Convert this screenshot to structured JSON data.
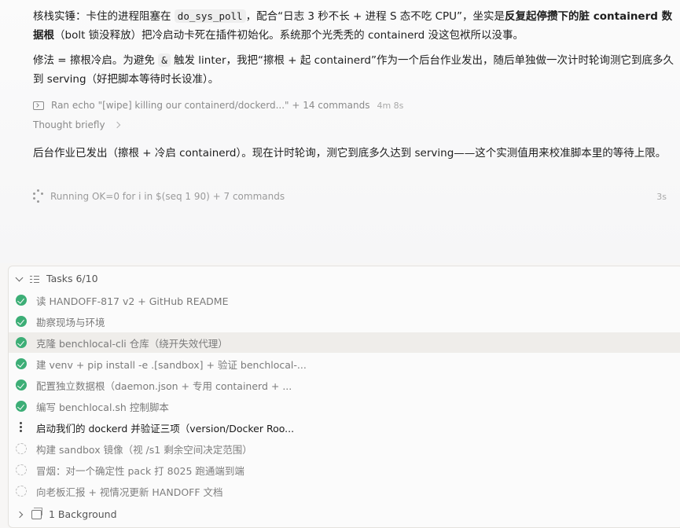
{
  "messages": [
    {
      "parts": [
        {
          "t": "核栈实锤：卡住的进程阻塞在 "
        },
        {
          "t": "do_sys_poll",
          "code": true
        },
        {
          "t": "，配合“日志 3 秒不长 + 进程 S 态不吃 CPU”，坐实是"
        },
        {
          "t": "反复起停攒下的脏 containerd 数据根",
          "bold": true
        },
        {
          "t": "（bolt 锁没释放）把冷启动卡死在插件初始化。系统那个光秃秃的 containerd 没这包袱所以没事。"
        }
      ]
    },
    {
      "parts": [
        {
          "t": "修法 = 擦根冷启。为避免 "
        },
        {
          "t": "&",
          "code": true
        },
        {
          "t": " 触发 linter，我把“擦根 + 起 containerd”作为一个后台作业发出，随后单独做一次计时轮询测它到底多久到 serving（好把脚本等待时长设准）。"
        }
      ]
    },
    {
      "parts": [
        {
          "t": "后台作业已发出（擦根 + 冷启 containerd）。现在计时轮询，测它到底多久达到 serving——这个实测值用来校准脚本里的等待上限。"
        }
      ]
    }
  ],
  "cmd_summary": {
    "text": "Ran echo \"[wipe] killing our containerd/dockerd...\" + 14 commands",
    "duration": "4m 8s"
  },
  "thought": {
    "text": "Thought briefly"
  },
  "running": {
    "text": "Running OK=0 for i in $(seq 1 90) + 7 commands",
    "time": "3s"
  },
  "tasks": {
    "title": "Tasks 6/10",
    "items": [
      {
        "label": "读 HANDOFF-817 v2 + GitHub README",
        "status": "done"
      },
      {
        "label": "勘察现场与环境",
        "status": "done"
      },
      {
        "label": "克隆 benchlocal-cli 仓库（绕开失效代理）",
        "status": "done"
      },
      {
        "label": "建 venv + pip install -e .[sandbox] + 验证 benchlocal-...",
        "status": "done"
      },
      {
        "label": "配置独立数据根（daemon.json + 专用 containerd + ...",
        "status": "done"
      },
      {
        "label": "编写 benchlocal.sh 控制脚本",
        "status": "done"
      },
      {
        "label": "启动我们的 dockerd 并验证三项（version/Docker Roo...",
        "status": "in_progress"
      },
      {
        "label": "构建 sandbox 镜像（视 /s1 剩余空间决定范围）",
        "status": "pending"
      },
      {
        "label": "冒烟：对一个确定性 pack 打 8025 跑通端到端",
        "status": "pending"
      },
      {
        "label": "向老板汇报 + 视情况更新 HANDOFF 文档",
        "status": "pending"
      }
    ]
  },
  "background": {
    "label": "1 Background"
  },
  "colors": {
    "done": "#3cae76",
    "highlight": "#efedea"
  }
}
